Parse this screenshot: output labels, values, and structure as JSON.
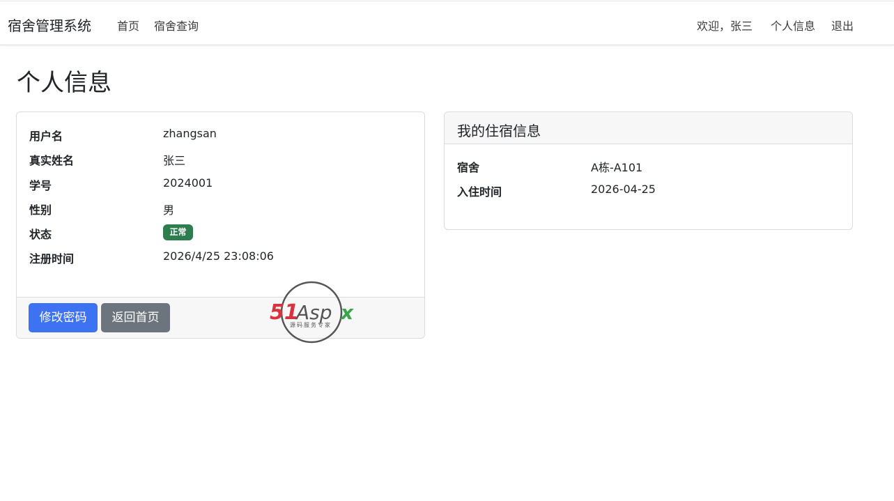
{
  "navbar": {
    "brand": "宿舍管理系统",
    "links": [
      "首页",
      "宿舍查询"
    ],
    "welcome": "欢迎，张三",
    "profile": "个人信息",
    "logout": "退出"
  },
  "page": {
    "title": "个人信息"
  },
  "profile_card": {
    "rows": [
      {
        "label": "用户名",
        "value": "zhangsan"
      },
      {
        "label": "真实姓名",
        "value": "张三"
      },
      {
        "label": "学号",
        "value": "2024001"
      },
      {
        "label": "性别",
        "value": "男"
      },
      {
        "label": "状态",
        "value": "正常"
      },
      {
        "label": "注册时间",
        "value": "2026/4/25 23:08:06"
      }
    ],
    "status_color": "#2e7d4f",
    "buttons": {
      "change_password": "修改密码",
      "back_home": "返回首页"
    }
  },
  "dorm_card": {
    "title": "我的住宿信息",
    "rows": [
      {
        "label": "宿舍",
        "value": "A栋-A101"
      },
      {
        "label": "入住时间",
        "value": "2026-04-25"
      }
    ]
  },
  "watermark": {
    "logo_text": "51Aspx",
    "tagline": "源码服务专家",
    "colors": {
      "red": "#d9333f",
      "green": "#3aa64a",
      "gray": "#555555"
    }
  }
}
